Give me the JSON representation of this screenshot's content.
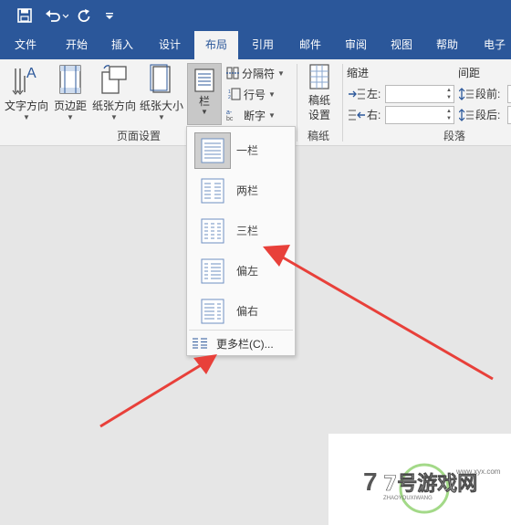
{
  "quick_access": {
    "save": "save-icon",
    "undo": "undo-icon",
    "redo": "redo-icon",
    "customize": "customize-icon"
  },
  "tabs": [
    "文件",
    "开始",
    "插入",
    "设计",
    "布局",
    "引用",
    "邮件",
    "审阅",
    "视图",
    "帮助",
    "电子"
  ],
  "active_tab": "布局",
  "ribbon": {
    "page_setup": {
      "label": "页面设置",
      "text_direction": "文字方向",
      "margins": "页边距",
      "orientation": "纸张方向",
      "size": "纸张大小",
      "columns": "栏",
      "breaks": "分隔符",
      "line_numbers": "行号",
      "hyphenation": "断字"
    },
    "draft": {
      "label": "稿纸",
      "button_line1": "稿纸",
      "button_line2": "设置"
    },
    "paragraph": {
      "label": "段落",
      "indent_header": "缩进",
      "spacing_header": "间距",
      "indent_left": "左:",
      "indent_right": "右:",
      "spacing_before": "段前:",
      "spacing_after": "段后:"
    }
  },
  "columns_menu": {
    "options": [
      "一栏",
      "两栏",
      "三栏",
      "偏左",
      "偏右"
    ],
    "selected": "一栏",
    "more": "更多栏(C)..."
  },
  "watermark": {
    "brand": "7号游戏网",
    "sub": "ZHAOYOUXIWANG",
    "url": "www.xyx.com"
  },
  "colors": {
    "accent": "#2b579a",
    "arrow": "#e8403a"
  }
}
